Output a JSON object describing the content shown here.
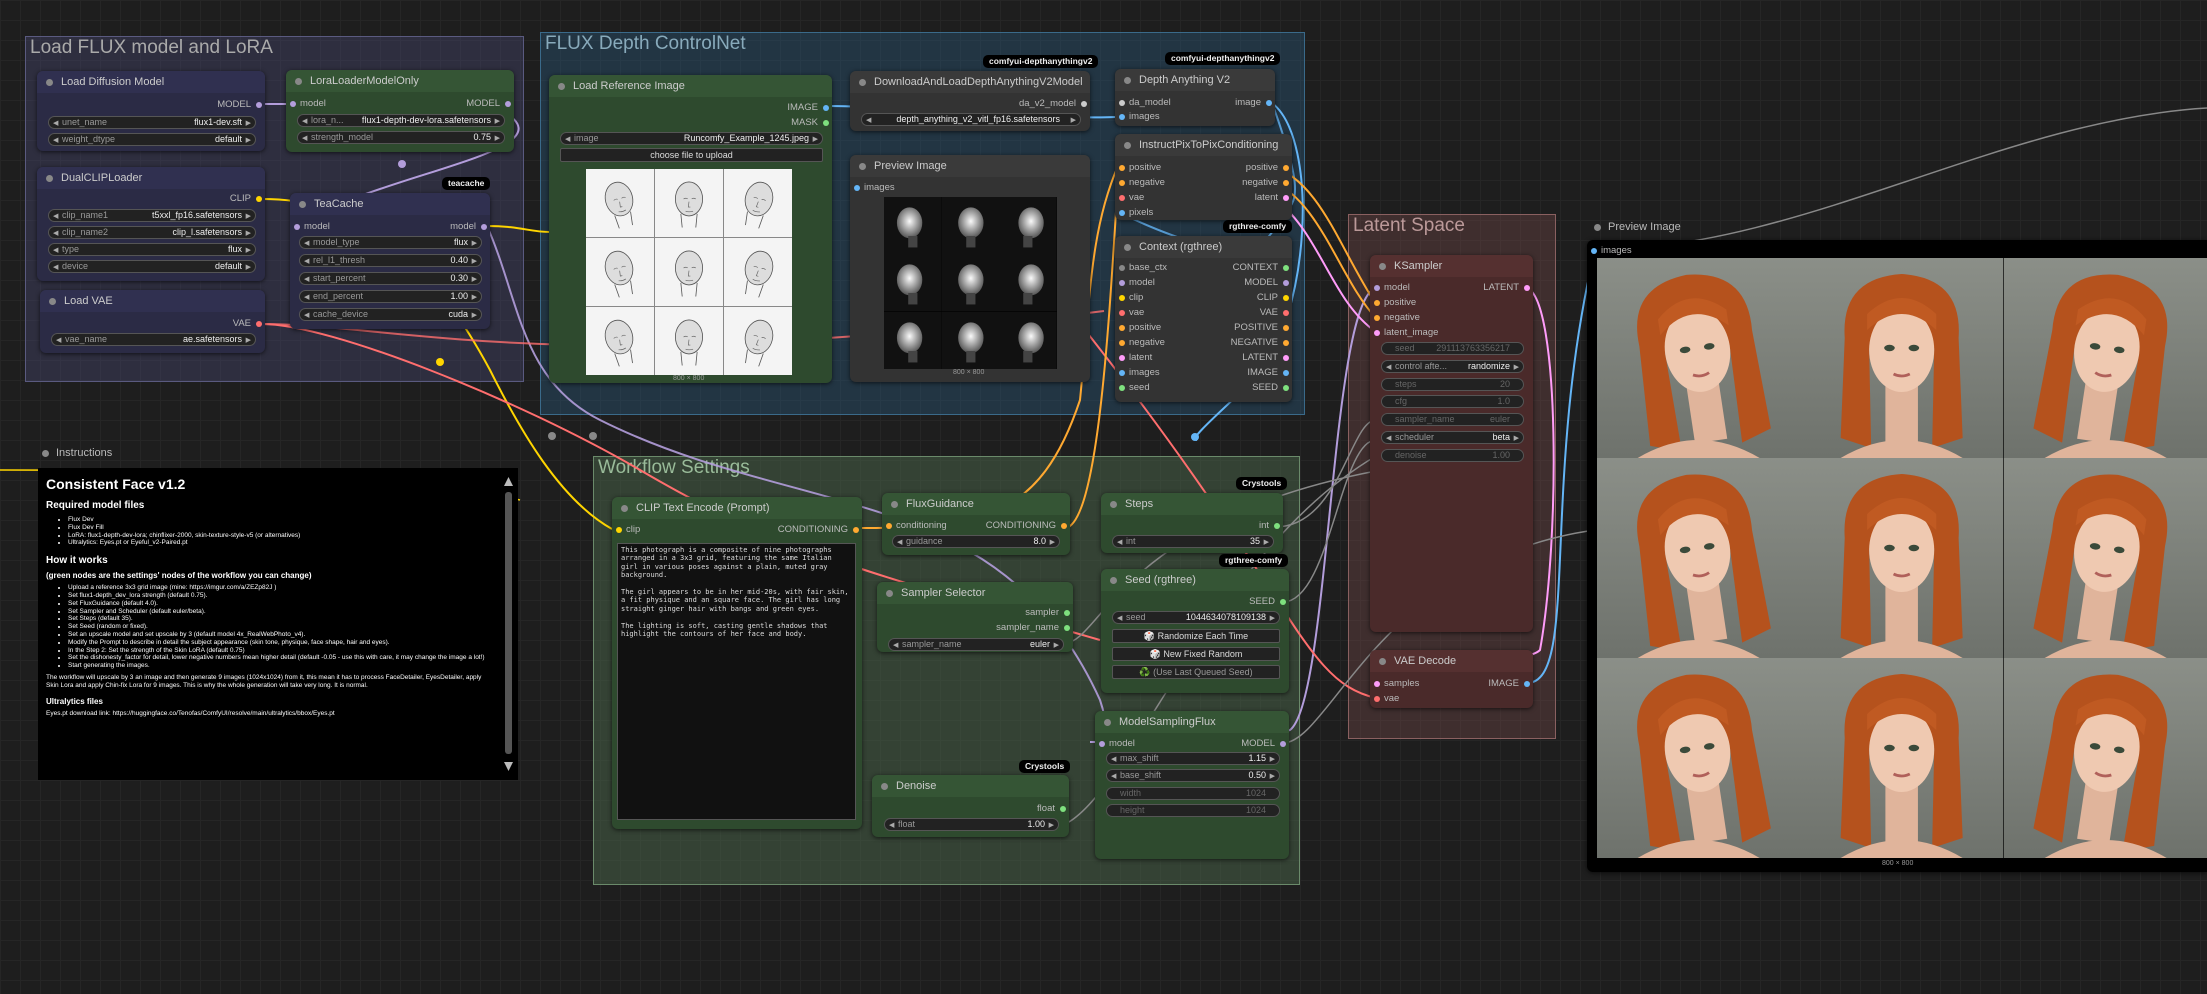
{
  "groups": {
    "load_flux": "Load FLUX model and LoRA",
    "depth": "FLUX Depth ControlNet",
    "workflow": "Workflow Settings",
    "latent": "Latent Space"
  },
  "badges": {
    "teacache": "teacache",
    "depth_a": "comfyui-depthanythingv2",
    "depth_b": "comfyui-depthanythingv2",
    "rgthree_ctx": "rgthree-comfy",
    "crystools_steps": "Crystools",
    "rgthree_seed": "rgthree-comfy",
    "crystools_denoise": "Crystools"
  },
  "nodes": {
    "load_diffusion": {
      "title": "Load Diffusion Model",
      "out_model": "MODEL",
      "unet_label": "unet_name",
      "unet_value": "flux1-dev.sft",
      "dtype_label": "weight_dtype",
      "dtype_value": "default"
    },
    "lora_loader": {
      "title": "LoraLoaderModelOnly",
      "in_model": "model",
      "out_model": "MODEL",
      "lora_label": "lora_n...",
      "lora_value": "flux1-depth-dev-lora.safetensors",
      "strength_label": "strength_model",
      "strength_value": "0.75"
    },
    "dual_clip": {
      "title": "DualCLIPLoader",
      "out_clip": "CLIP",
      "clip1_label": "clip_name1",
      "clip1_value": "t5xxl_fp16.safetensors",
      "clip2_label": "clip_name2",
      "clip2_value": "clip_l.safetensors",
      "type_label": "type",
      "type_value": "flux",
      "device_label": "device",
      "device_value": "default"
    },
    "teacache": {
      "title": "TeaCache",
      "in_model": "model",
      "out_model": "model",
      "model_type_label": "model_type",
      "model_type_value": "flux",
      "rel_label": "rel_l1_thresh",
      "rel_value": "0.40",
      "start_label": "start_percent",
      "start_value": "0.30",
      "end_label": "end_percent",
      "end_value": "1.00",
      "cache_label": "cache_device",
      "cache_value": "cuda"
    },
    "load_vae": {
      "title": "Load VAE",
      "out_vae": "VAE",
      "vae_label": "vae_name",
      "vae_value": "ae.safetensors"
    },
    "load_image": {
      "title": "Load Reference Image",
      "out_image": "IMAGE",
      "out_mask": "MASK",
      "image_label": "image",
      "image_value": "Runcomfy_Example_1245.jpeg",
      "upload_label": "choose file to upload",
      "size": "800 × 800"
    },
    "download_depth": {
      "title": "DownloadAndLoadDepthAnythingV2Model",
      "out": "da_v2_model",
      "model_value": "depth_anything_v2_vitl_fp16.safetensors"
    },
    "preview_depth": {
      "title": "Preview Image",
      "in_images": "images",
      "size": "800 × 800"
    },
    "depth_anything": {
      "title": "Depth Anything V2",
      "in_model": "da_model",
      "in_images": "images",
      "out_image": "image"
    },
    "instructpix": {
      "title": "InstructPixToPixConditioning",
      "inputs": [
        "positive",
        "negative",
        "vae",
        "pixels"
      ],
      "outputs": [
        "positive",
        "negative",
        "latent"
      ]
    },
    "context": {
      "title": "Context (rgthree)",
      "inputs": [
        "base_ctx",
        "model",
        "clip",
        "vae",
        "positive",
        "negative",
        "latent",
        "images",
        "seed"
      ],
      "outputs": [
        "CONTEXT",
        "MODEL",
        "CLIP",
        "VAE",
        "POSITIVE",
        "NEGATIVE",
        "LATENT",
        "IMAGE",
        "SEED"
      ]
    },
    "clip_text": {
      "title": "CLIP Text Encode (Prompt)",
      "in_clip": "clip",
      "out": "CONDITIONING",
      "prompt": "This photograph is a composite of nine photographs arranged in a 3x3 grid, featuring the same Italian girl in various poses against a plain, muted gray background.\n\nThe girl appears to be in her mid-20s, with fair skin, a fit physique and an square face. The girl has long straight ginger hair with bangs and green eyes.\n\nThe lighting is soft, casting gentle shadows that highlight the contours of her face and body."
    },
    "flux_guidance": {
      "title": "FluxGuidance",
      "in": "conditioning",
      "out": "CONDITIONING",
      "guidance_label": "guidance",
      "guidance_value": "8.0"
    },
    "sampler_selector": {
      "title": "Sampler Selector",
      "out_sampler": "sampler",
      "out_name": "sampler_name",
      "sampler_label": "sampler_name",
      "sampler_value": "euler"
    },
    "steps": {
      "title": "Steps",
      "out": "int",
      "int_label": "int",
      "int_value": "35"
    },
    "seed": {
      "title": "Seed (rgthree)",
      "out": "SEED",
      "seed_label": "seed",
      "seed_value": "1044634078109138",
      "btn_random": "🎲 Randomize Each Time",
      "btn_new": "🎲 New Fixed Random",
      "btn_last": "♻️ (Use Last Queued Seed)"
    },
    "model_sampling": {
      "title": "ModelSamplingFlux",
      "in_model": "model",
      "out_model": "MODEL",
      "max_shift_label": "max_shift",
      "max_shift_value": "1.15",
      "base_shift_label": "base_shift",
      "base_shift_value": "0.50",
      "width_label": "width",
      "width_value": "1024",
      "height_label": "height",
      "height_value": "1024"
    },
    "denoise": {
      "title": "Denoise",
      "out": "float",
      "float_label": "float",
      "float_value": "1.00"
    },
    "ksampler": {
      "title": "KSampler",
      "out": "LATENT",
      "inputs": [
        "model",
        "positive",
        "negative",
        "latent_image"
      ],
      "widgets": [
        {
          "label": "seed",
          "value": "291113763356217",
          "dim": true
        },
        {
          "label": "control afte...",
          "value": "randomize",
          "dim": false
        },
        {
          "label": "steps",
          "value": "20",
          "dim": true
        },
        {
          "label": "cfg",
          "value": "1.0",
          "dim": true
        },
        {
          "label": "sampler_name",
          "value": "euler",
          "dim": true
        },
        {
          "label": "scheduler",
          "value": "beta",
          "dim": false
        },
        {
          "label": "denoise",
          "value": "1.00",
          "dim": true
        }
      ]
    },
    "vae_decode": {
      "title": "VAE Decode",
      "in_samples": "samples",
      "in_vae": "vae",
      "out": "IMAGE"
    },
    "preview_final": {
      "title": "Preview Image",
      "in_images": "images",
      "size": "800 × 800"
    },
    "instructions": {
      "title": "Instructions"
    }
  },
  "instructions": {
    "heading": "Consistent Face v1.2",
    "req_heading": "Required model files",
    "req_items": [
      "Flux Dev",
      "Flux Dev Fill",
      "LoRA: flux1-depth-dev-lora; chinflixer-2000, skin-texture-style-v5 (or alternatives)",
      "Ultralytics: Eyes.pt or Eyeful_v2-Paired.pt"
    ],
    "how_heading": "How it works",
    "how_sub": "(green nodes are the settings' nodes of the workflow you can change)",
    "how_items": [
      "Upload a reference 3x3 grid image (mine: https://imgur.com/a/ZEZp82J )",
      "Set flux1-depth_dev_lora strength (default 0.75).",
      "Set FluxGuidance (default 4.0).",
      "Set Sampler and Scheduler (default euler/beta).",
      "Set Steps (default 35).",
      "Set Seed (random or fixed).",
      "Set an upscale model and set upscale by 3 (default model 4x_RealWebPhoto_v4).",
      "Modify the Prompt to describe in detail the subject appearance (skin tone, physique, face shape, hair and eyes).",
      "In the Step 2: Set the strength of the Skin LoRA (default 0.75)",
      "Set the dishonesty_factor for detail, lower negative numbers mean higher detail (default -0.05 - use this with care, it may change the image a lot!)",
      "Start generating the images."
    ],
    "para": "The workflow will upscale by 3 an image and then generate 9 images (1024x1024) from it, this mean it has to process FaceDetailer, EyesDetailer, apply Skin Lora and apply Chin-fix Lora for 9 images. This is why the whole generation will take very long. It is normal.",
    "ultra_heading": "Ultralytics files",
    "ultra_link": "Eyes.pt download link: https://huggingface.co/Tenofas/ComfyUI/resolve/main/ultralytics/bbox/Eyes.pt"
  },
  "colors": {
    "background": "#1e1e1e",
    "group_flux": "#3a3a55",
    "group_depth": "#1f3d55",
    "group_workflow": "#3d5040",
    "group_latent": "#4f3535",
    "node_blue": "#2b2b45",
    "node_green": "#2e4a2e",
    "node_red": "#4a2a2a",
    "node_gray": "#333333",
    "wire_model": "#b39ddb",
    "wire_clip": "#ffd500",
    "wire_vae": "#ff6e6e",
    "wire_image": "#64b5f6",
    "wire_conditioning": "#ffa931",
    "wire_latent": "#ff9cf9"
  }
}
